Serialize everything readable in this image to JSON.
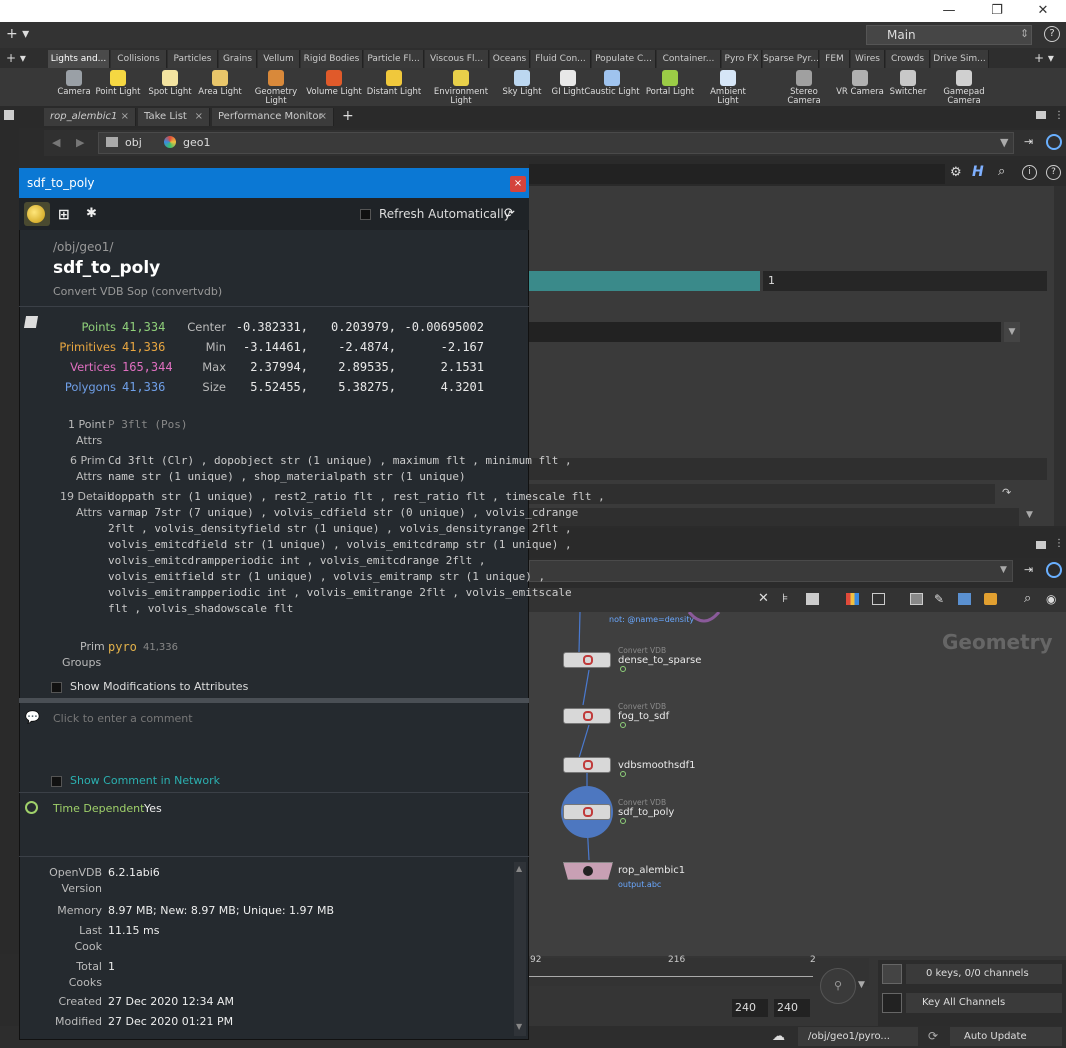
{
  "window": {
    "minimize": "—",
    "maximize": "❐",
    "close": "✕"
  },
  "desktop": {
    "selector": "Main"
  },
  "shelf_tabs": [
    "Lights and...",
    "Collisions",
    "Particles",
    "Grains",
    "Vellum",
    "Rigid Bodies",
    "Particle Fl...",
    "Viscous Fl...",
    "Oceans",
    "Fluid Con...",
    "Populate C...",
    "Container...",
    "Pyro FX",
    "Sparse Pyr...",
    "FEM",
    "Wires",
    "Crowds",
    "Drive Sim..."
  ],
  "shelf_tools": [
    {
      "label": "Camera",
      "color": "#9aa0a6"
    },
    {
      "label": "Point Light",
      "color": "#f5d742"
    },
    {
      "label": "Spot Light",
      "color": "#f3e3a0"
    },
    {
      "label": "Area Light",
      "color": "#e9c66a"
    },
    {
      "label": "Geometry Light",
      "color": "#d9893a"
    },
    {
      "label": "Volume Light",
      "color": "#e05a2a"
    },
    {
      "label": "Distant Light",
      "color": "#f0c83c"
    },
    {
      "label": "Environment Light",
      "color": "#e8d04a"
    },
    {
      "label": "Sky Light",
      "color": "#bcd7f0"
    },
    {
      "label": "GI Light",
      "color": "#e8e8e8"
    },
    {
      "label": "Caustic Light",
      "color": "#9fc3ee"
    },
    {
      "label": "Portal Light",
      "color": "#9bcc46"
    },
    {
      "label": "Ambient Light",
      "color": "#d6e6f7"
    },
    {
      "label": "Stereo Camera",
      "color": "#a0a0a0"
    },
    {
      "label": "VR Camera",
      "color": "#b0b0b0"
    },
    {
      "label": "Switcher",
      "color": "#c8c8c8"
    },
    {
      "label": "Gamepad Camera",
      "color": "#d0d0d0"
    }
  ],
  "pane_tabs": [
    "rop_alembic1",
    "Take List",
    "Performance Monitor"
  ],
  "path": {
    "root": "obj",
    "node": "geo1"
  },
  "info": {
    "title": "sdf_to_poly",
    "refresh_label": "Refresh Automatically",
    "path": "/obj/geo1/",
    "name": "sdf_to_poly",
    "type": "Convert VDB Sop (convertvdb)",
    "counts": [
      {
        "label": "Points",
        "value": "41,334",
        "color": "#8fd07a"
      },
      {
        "label": "Primitives",
        "value": "41,336",
        "color": "#e8a640"
      },
      {
        "label": "Vertices",
        "value": "165,344",
        "color": "#e06fc0"
      },
      {
        "label": "Polygons",
        "value": "41,336",
        "color": "#6f9fe8"
      }
    ],
    "bounds": [
      {
        "label": "Center",
        "values": [
          "-0.382331,",
          "0.203979,",
          "-0.00695002"
        ]
      },
      {
        "label": "Min",
        "values": [
          "-3.14461,",
          "-2.4874,",
          "-2.167"
        ]
      },
      {
        "label": "Max",
        "values": [
          "2.37994,",
          "2.89535,",
          "2.1531"
        ]
      },
      {
        "label": "Size",
        "values": [
          "5.52455,",
          "5.38275,",
          "4.3201"
        ]
      }
    ],
    "point_attrs": {
      "count": "1 Point",
      "sub": "Attrs",
      "line": "P 3flt (Pos)"
    },
    "prim_attrs": {
      "count": "6 Prim",
      "sub": "Attrs",
      "line1": "Cd 3flt (Clr) , dopobject str (1 unique) , maximum flt , minimum flt ,",
      "line2": "name str (1 unique) , shop_materialpath str (1 unique)"
    },
    "detail_attrs": {
      "count": "19 Detail",
      "sub": "Attrs",
      "lines": [
        "doppath str (1 unique) , rest2_ratio flt , rest_ratio flt , timescale flt ,",
        "varmap 7str (7 unique) , volvis_cdfield str (0 unique) , volvis_cdrange",
        "2flt , volvis_densityfield str (1 unique) , volvis_densityrange 2flt ,",
        "volvis_emitcdfield str (1 unique) , volvis_emitcdramp str (1 unique) ,",
        "volvis_emitcdrampperiodic int , volvis_emitcdrange 2flt ,",
        "volvis_emitfield str (1 unique) , volvis_emitramp str (1 unique) ,",
        "volvis_emitrampperiodic int , volvis_emitrange 2flt , volvis_emitscale",
        "flt , volvis_shadowscale flt"
      ]
    },
    "prim_groups": {
      "label": "Prim",
      "sub": "Groups",
      "name": "pyro",
      "count": "41,336"
    },
    "show_mods": "Show Modifications to Attributes",
    "comment_placeholder": "Click to enter a comment",
    "show_comment": "Show Comment in Network",
    "time_dep_label": "Time Dependent",
    "time_dep_value": "Yes",
    "stats": [
      {
        "label": "OpenVDB",
        "sub": "Version",
        "value": "6.2.1abi6"
      },
      {
        "label": "Memory",
        "sub": "",
        "value": "8.97 MB; New: 8.97 MB; Unique: 1.97 MB"
      },
      {
        "label": "Last",
        "sub": "Cook",
        "value": "11.15 ms"
      },
      {
        "label": "Total",
        "sub": "Cooks",
        "value": "1"
      },
      {
        "label": "Created",
        "sub": "",
        "value": "27 Dec 2020 12:34 AM"
      },
      {
        "label": "Modified",
        "sub": "",
        "value": "27 Dec 2020 01:21 PM"
      }
    ]
  },
  "param_value": "1",
  "network": {
    "context_label": "Geometry",
    "filter_text": "not: @name=density",
    "nodes": [
      {
        "cls": "Convert VDB",
        "name": "dense_to_sparse"
      },
      {
        "cls": "Convert VDB",
        "name": "fog_to_sdf"
      },
      {
        "cls": "",
        "name": "vdbsmoothsdf1"
      },
      {
        "cls": "Convert VDB",
        "name": "sdf_to_poly"
      },
      {
        "cls": "",
        "name": "rop_alembic1",
        "sub": "output.abc"
      }
    ]
  },
  "timeline": {
    "ticks": [
      "92",
      "216",
      "2"
    ],
    "frame_a": "240",
    "frame_b": "240",
    "keys": "0 keys, 0/0 channels",
    "key_all": "Key All Channels"
  },
  "status": {
    "path": "/obj/geo1/pyro...",
    "mode": "Auto Update"
  }
}
